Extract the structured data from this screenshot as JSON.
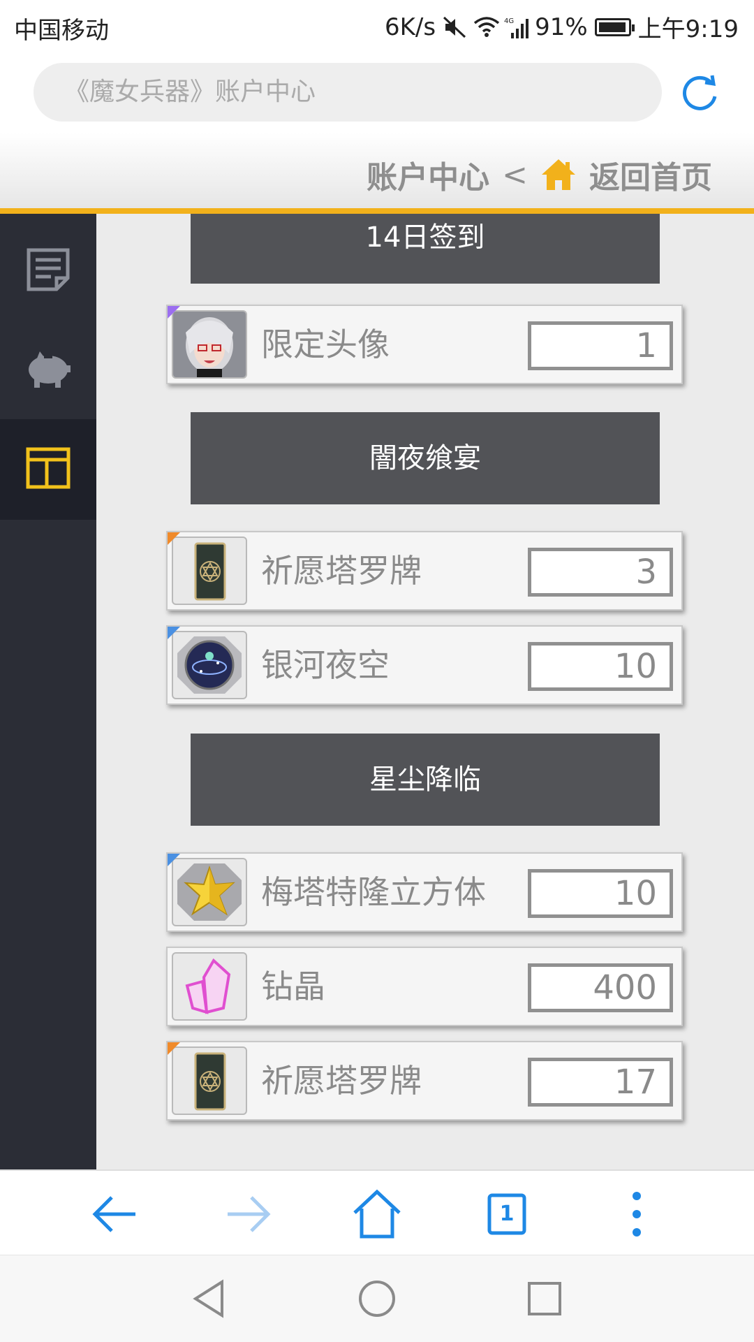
{
  "status_bar": {
    "carrier": "中国移动",
    "speed": "6K/s",
    "battery": "91%",
    "time": "上午9:19",
    "icons": [
      "mute-icon",
      "wifi-icon",
      "signal-4g-icon",
      "battery-icon"
    ]
  },
  "browser": {
    "url_text": "《魔女兵器》账户中心",
    "tab_count": "1"
  },
  "header": {
    "current_page": "账户中心",
    "separator": "<",
    "home_link": "返回首页"
  },
  "sidebar": {
    "items": [
      {
        "icon": "document-icon"
      },
      {
        "icon": "piggy-bank-icon"
      },
      {
        "icon": "layout-icon",
        "active": true
      }
    ]
  },
  "sections": [
    {
      "title": "14日签到",
      "rewards": [
        {
          "name": "限定头像",
          "qty": "1",
          "icon": "avatar-icon",
          "corner": "#9b6ef0"
        }
      ]
    },
    {
      "title": "闇夜飨宴",
      "rewards": [
        {
          "name": "祈愿塔罗牌",
          "qty": "3",
          "icon": "tarot-card-icon",
          "corner": "#f08a2a"
        },
        {
          "name": "银河夜空",
          "qty": "10",
          "icon": "galaxy-orb-icon",
          "corner": "#4a90e2"
        }
      ]
    },
    {
      "title": "星尘降临",
      "rewards": [
        {
          "name": "梅塔特隆立方体",
          "qty": "10",
          "icon": "star-cube-icon",
          "corner": "#4a90e2"
        },
        {
          "name": "钻晶",
          "qty": "400",
          "icon": "crystal-icon",
          "corner": ""
        },
        {
          "name": "祈愿塔罗牌",
          "qty": "17",
          "icon": "tarot-card-icon",
          "corner": "#f08a2a"
        }
      ]
    }
  ],
  "colors": {
    "accent": "#f2b11b",
    "browser_blue": "#1e88e5",
    "section_bg": "#525357",
    "sidebar_bg": "#2b2d36"
  }
}
